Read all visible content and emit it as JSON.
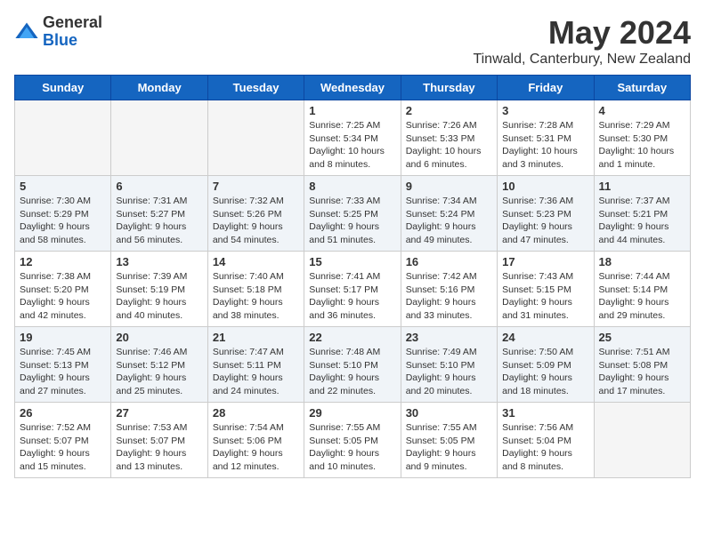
{
  "header": {
    "logo_general": "General",
    "logo_blue": "Blue",
    "title": "May 2024",
    "subtitle": "Tinwald, Canterbury, New Zealand"
  },
  "days_of_week": [
    "Sunday",
    "Monday",
    "Tuesday",
    "Wednesday",
    "Thursday",
    "Friday",
    "Saturday"
  ],
  "weeks": [
    [
      {
        "day": "",
        "info": ""
      },
      {
        "day": "",
        "info": ""
      },
      {
        "day": "",
        "info": ""
      },
      {
        "day": "1",
        "info": "Sunrise: 7:25 AM\nSunset: 5:34 PM\nDaylight: 10 hours\nand 8 minutes."
      },
      {
        "day": "2",
        "info": "Sunrise: 7:26 AM\nSunset: 5:33 PM\nDaylight: 10 hours\nand 6 minutes."
      },
      {
        "day": "3",
        "info": "Sunrise: 7:28 AM\nSunset: 5:31 PM\nDaylight: 10 hours\nand 3 minutes."
      },
      {
        "day": "4",
        "info": "Sunrise: 7:29 AM\nSunset: 5:30 PM\nDaylight: 10 hours\nand 1 minute."
      }
    ],
    [
      {
        "day": "5",
        "info": "Sunrise: 7:30 AM\nSunset: 5:29 PM\nDaylight: 9 hours\nand 58 minutes."
      },
      {
        "day": "6",
        "info": "Sunrise: 7:31 AM\nSunset: 5:27 PM\nDaylight: 9 hours\nand 56 minutes."
      },
      {
        "day": "7",
        "info": "Sunrise: 7:32 AM\nSunset: 5:26 PM\nDaylight: 9 hours\nand 54 minutes."
      },
      {
        "day": "8",
        "info": "Sunrise: 7:33 AM\nSunset: 5:25 PM\nDaylight: 9 hours\nand 51 minutes."
      },
      {
        "day": "9",
        "info": "Sunrise: 7:34 AM\nSunset: 5:24 PM\nDaylight: 9 hours\nand 49 minutes."
      },
      {
        "day": "10",
        "info": "Sunrise: 7:36 AM\nSunset: 5:23 PM\nDaylight: 9 hours\nand 47 minutes."
      },
      {
        "day": "11",
        "info": "Sunrise: 7:37 AM\nSunset: 5:21 PM\nDaylight: 9 hours\nand 44 minutes."
      }
    ],
    [
      {
        "day": "12",
        "info": "Sunrise: 7:38 AM\nSunset: 5:20 PM\nDaylight: 9 hours\nand 42 minutes."
      },
      {
        "day": "13",
        "info": "Sunrise: 7:39 AM\nSunset: 5:19 PM\nDaylight: 9 hours\nand 40 minutes."
      },
      {
        "day": "14",
        "info": "Sunrise: 7:40 AM\nSunset: 5:18 PM\nDaylight: 9 hours\nand 38 minutes."
      },
      {
        "day": "15",
        "info": "Sunrise: 7:41 AM\nSunset: 5:17 PM\nDaylight: 9 hours\nand 36 minutes."
      },
      {
        "day": "16",
        "info": "Sunrise: 7:42 AM\nSunset: 5:16 PM\nDaylight: 9 hours\nand 33 minutes."
      },
      {
        "day": "17",
        "info": "Sunrise: 7:43 AM\nSunset: 5:15 PM\nDaylight: 9 hours\nand 31 minutes."
      },
      {
        "day": "18",
        "info": "Sunrise: 7:44 AM\nSunset: 5:14 PM\nDaylight: 9 hours\nand 29 minutes."
      }
    ],
    [
      {
        "day": "19",
        "info": "Sunrise: 7:45 AM\nSunset: 5:13 PM\nDaylight: 9 hours\nand 27 minutes."
      },
      {
        "day": "20",
        "info": "Sunrise: 7:46 AM\nSunset: 5:12 PM\nDaylight: 9 hours\nand 25 minutes."
      },
      {
        "day": "21",
        "info": "Sunrise: 7:47 AM\nSunset: 5:11 PM\nDaylight: 9 hours\nand 24 minutes."
      },
      {
        "day": "22",
        "info": "Sunrise: 7:48 AM\nSunset: 5:10 PM\nDaylight: 9 hours\nand 22 minutes."
      },
      {
        "day": "23",
        "info": "Sunrise: 7:49 AM\nSunset: 5:10 PM\nDaylight: 9 hours\nand 20 minutes."
      },
      {
        "day": "24",
        "info": "Sunrise: 7:50 AM\nSunset: 5:09 PM\nDaylight: 9 hours\nand 18 minutes."
      },
      {
        "day": "25",
        "info": "Sunrise: 7:51 AM\nSunset: 5:08 PM\nDaylight: 9 hours\nand 17 minutes."
      }
    ],
    [
      {
        "day": "26",
        "info": "Sunrise: 7:52 AM\nSunset: 5:07 PM\nDaylight: 9 hours\nand 15 minutes."
      },
      {
        "day": "27",
        "info": "Sunrise: 7:53 AM\nSunset: 5:07 PM\nDaylight: 9 hours\nand 13 minutes."
      },
      {
        "day": "28",
        "info": "Sunrise: 7:54 AM\nSunset: 5:06 PM\nDaylight: 9 hours\nand 12 minutes."
      },
      {
        "day": "29",
        "info": "Sunrise: 7:55 AM\nSunset: 5:05 PM\nDaylight: 9 hours\nand 10 minutes."
      },
      {
        "day": "30",
        "info": "Sunrise: 7:55 AM\nSunset: 5:05 PM\nDaylight: 9 hours\nand 9 minutes."
      },
      {
        "day": "31",
        "info": "Sunrise: 7:56 AM\nSunset: 5:04 PM\nDaylight: 9 hours\nand 8 minutes."
      },
      {
        "day": "",
        "info": ""
      }
    ]
  ]
}
